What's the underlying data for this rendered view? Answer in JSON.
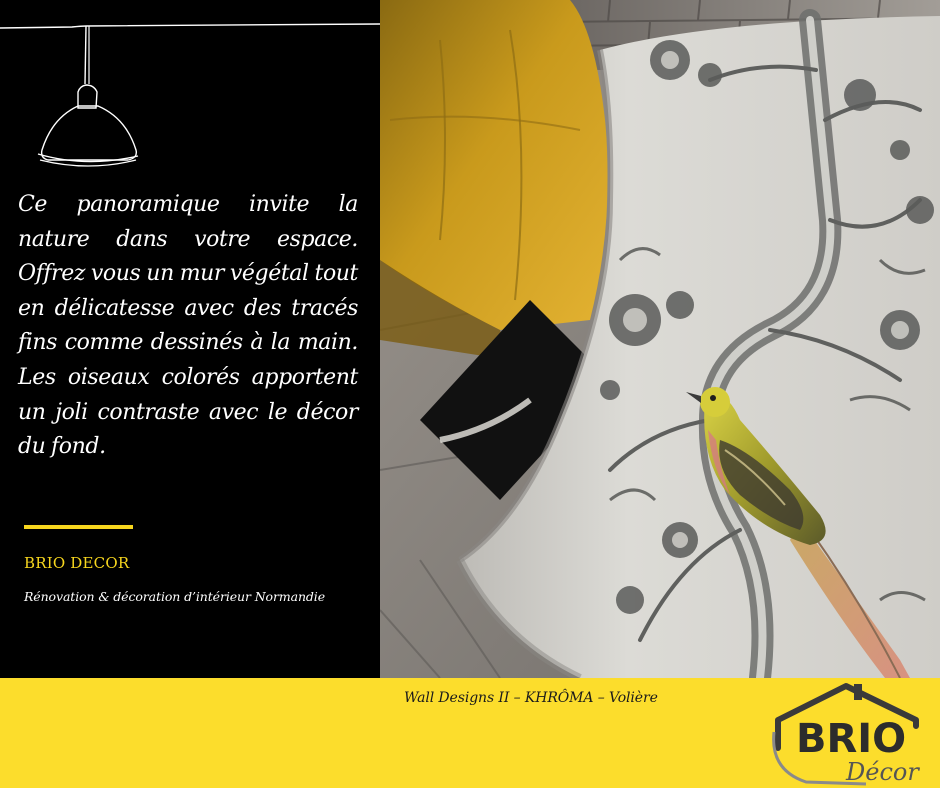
{
  "description": "Ce panoramique  invite la nature dans votre espace. Offrez vous un mur végétal tout en délicatesse avec des tracés fins comme dessinés à la main. Les oiseaux colorés apportent un joli contraste avec le décor du fond.",
  "brand": {
    "name": "BRIO DECOR",
    "tagline": "Rénovation & décoration d’intérieur Normandie"
  },
  "caption": "Wall Designs II – KHRÔMA – Volière",
  "logo": {
    "word_main": "BRIO",
    "word_script": "Décor"
  },
  "colors": {
    "accent_yellow": "#fcdd2c",
    "panel_black": "#000000",
    "text_white": "#ffffff",
    "logo_dark": "#2c2c2c",
    "mustard_chair": "#c99a1c",
    "wallpaper_grey": "#d9d8d3"
  },
  "icons": {
    "lamp": "pendant-lamp-icon",
    "logo_house": "house-roof-icon"
  }
}
